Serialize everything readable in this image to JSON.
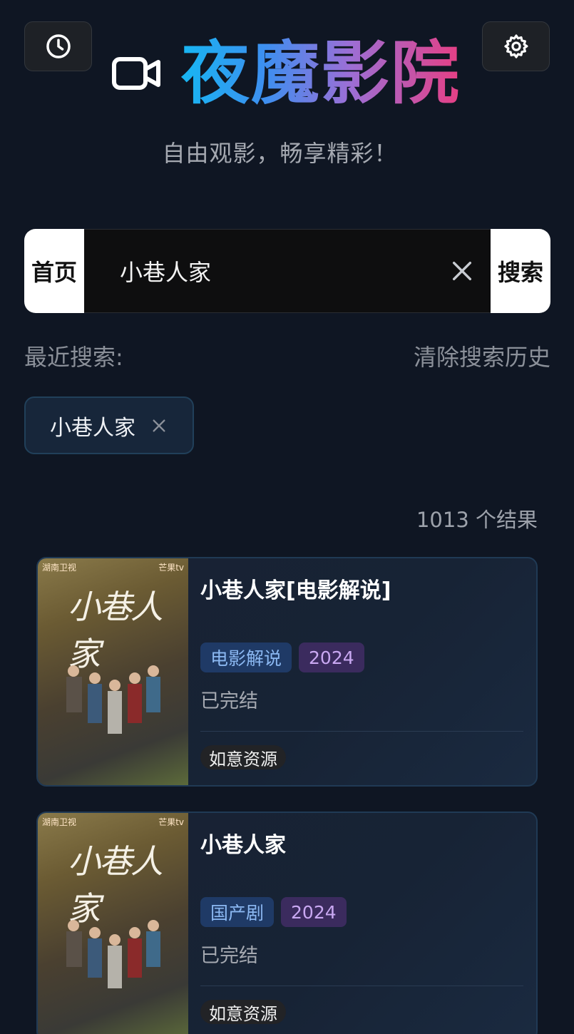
{
  "header": {
    "history_icon": "clock-icon",
    "settings_icon": "gear-icon",
    "brand_icon": "video-camera-icon",
    "title": "夜魔影院",
    "subtitle": "自由观影，畅享精彩！"
  },
  "search": {
    "home_label": "首页",
    "value": "小巷人家",
    "clear_icon": "close-icon",
    "search_label": "搜索"
  },
  "recent": {
    "label": "最近搜索:",
    "clear_label": "清除搜索历史",
    "chips": [
      {
        "text": "小巷人家",
        "remove_icon": "close-icon"
      }
    ]
  },
  "results": {
    "count_text": "1013 个结果",
    "items": [
      {
        "title": "小巷人家[电影解说]",
        "type_tag": "电影解说",
        "year_tag": "2024",
        "status": "已完结",
        "source": "如意资源",
        "poster": {
          "channel": "湖南卫视",
          "platform": "芒果tv",
          "calligraphy": "小巷人家"
        }
      },
      {
        "title": "小巷人家",
        "type_tag": "国产剧",
        "year_tag": "2024",
        "status": "已完结",
        "source": "如意资源",
        "poster": {
          "channel": "湖南卫视",
          "platform": "芒果tv",
          "calligraphy": "小巷人家"
        }
      }
    ]
  },
  "colors": {
    "background": "#0f1623",
    "brand_gradient_start": "#17b6f2",
    "brand_gradient_end": "#e63f84",
    "type_tag": "#1f3a66",
    "year_tag": "#3b2b5e"
  }
}
